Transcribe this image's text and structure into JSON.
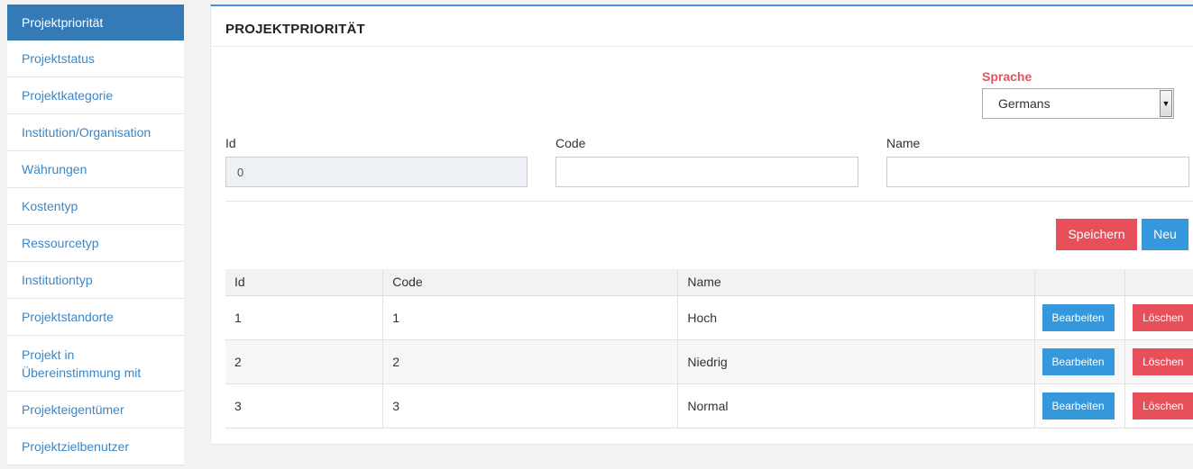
{
  "sidebar": {
    "items": [
      {
        "label": "Projektpriorität",
        "active": true
      },
      {
        "label": "Projektstatus"
      },
      {
        "label": "Projektkategorie"
      },
      {
        "label": "Institution/Organisation"
      },
      {
        "label": "Währungen"
      },
      {
        "label": "Kostentyp"
      },
      {
        "label": "Ressourcetyp"
      },
      {
        "label": "Institutiontyp"
      },
      {
        "label": "Projektstandorte"
      },
      {
        "label": "Projekt in Übereinstimmung mit"
      },
      {
        "label": "Projekteigentümer"
      },
      {
        "label": "Projektzielbenutzer"
      }
    ]
  },
  "panel": {
    "title": "PROJEKTPRIORITÄT"
  },
  "language": {
    "label": "Sprache",
    "selected": "Germans"
  },
  "form": {
    "id_label": "Id",
    "id_value": "0",
    "code_label": "Code",
    "code_value": "",
    "name_label": "Name",
    "name_value": ""
  },
  "actions": {
    "save": "Speichern",
    "new": "Neu"
  },
  "table": {
    "headers": [
      "Id",
      "Code",
      "Name",
      "",
      ""
    ],
    "rows": [
      {
        "id": "1",
        "code": "1",
        "name": "Hoch",
        "edit": "Bearbeiten",
        "delete": "Löschen"
      },
      {
        "id": "2",
        "code": "2",
        "name": "Niedrig",
        "edit": "Bearbeiten",
        "delete": "Löschen"
      },
      {
        "id": "3",
        "code": "3",
        "name": "Normal",
        "edit": "Bearbeiten",
        "delete": "Löschen"
      }
    ]
  },
  "colors": {
    "primary": "#337ab7",
    "accent_blue": "#3598dc",
    "danger": "#e7505a",
    "label_red": "#e8535b"
  }
}
